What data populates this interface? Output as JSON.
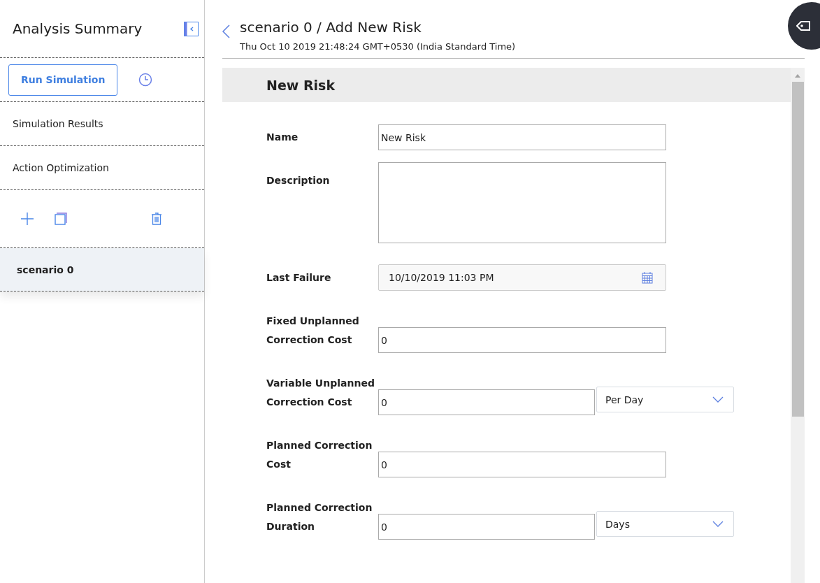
{
  "sidebar": {
    "title": "Analysis Summary",
    "run_button": "Run Simulation",
    "nav_items": [
      {
        "label": "Simulation Results",
        "selected": false
      },
      {
        "label": "Action Optimization",
        "selected": false
      }
    ],
    "scenarios": [
      {
        "label": "scenario 0",
        "selected": true
      }
    ]
  },
  "header": {
    "title": "scenario 0 / Add New Risk",
    "subtitle": "Thu Oct 10 2019 21:48:24 GMT+0530 (India Standard Time)"
  },
  "form": {
    "title": "New Risk",
    "fields": [
      {
        "kind": "text",
        "label": "Name",
        "value": "New Risk"
      },
      {
        "kind": "textarea",
        "label": "Description"
      },
      {
        "kind": "date",
        "label": "Last Failure",
        "value": "10/10/2019 11:03 PM"
      },
      {
        "kind": "text",
        "label": "Fixed Unplanned Correction Cost",
        "value": "0"
      },
      {
        "kind": "unit",
        "label": "Variable Unplanned Correction Cost",
        "value": "0",
        "unit": "Per Day"
      },
      {
        "kind": "text",
        "label": "Planned Correction Cost",
        "value": "0"
      },
      {
        "kind": "unit",
        "label": "Planned Correction Duration",
        "value": "0",
        "unit": "Days"
      }
    ]
  }
}
